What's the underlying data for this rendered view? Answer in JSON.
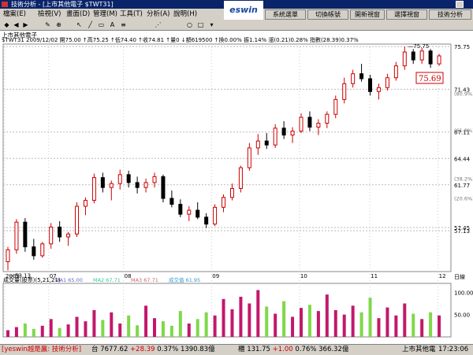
{
  "window": {
    "title": "技術分析 - [上市其他電子 $TWT31]"
  },
  "menu": {
    "items": [
      "檔案(E)",
      "檢視(V)",
      "畫面(D)",
      "管理(M)",
      "工具(T)",
      "分析(A)",
      "說明(H)"
    ]
  },
  "toolbar": {
    "brand": "eswin",
    "buttons": [
      "系統選單",
      "切換帳號",
      "開新視窗",
      "選擇視窗",
      "技術分析"
    ]
  },
  "instrument": {
    "name": "上市其他電子",
    "quote_line": "$TWT31 2009/12/02 開75.00 ↑高75.25 ↑低74.40 ↑收74.81 ↑量0 ↓額619500 ↑換0.00% 振1.14% 漲(0.21)0.28% 指數(28.39)0.37%",
    "last_price_label": "75.69"
  },
  "volume_panel": {
    "label": "成交量(股票)(5,21,21)",
    "ma_labels": [
      "MA1 65.00",
      "MA2 67.71",
      "MA3 67.71",
      "成交值 61.95"
    ]
  },
  "chart_data": {
    "type": "candlestick",
    "x_month_labels": [
      "2009",
      "07",
      "08",
      "09",
      "10",
      "11",
      "12"
    ],
    "y_ticks": [
      57.13,
      57.45,
      61.77,
      64.44,
      67.11,
      71.43,
      75.75
    ],
    "y_pct_labels": [
      "(20.6%)",
      "(38.2%)",
      "(61.8%)",
      "(80.9%)"
    ],
    "annotations": {
      "high": 75.75,
      "low": 53.13,
      "last": 75.69
    },
    "volume_ticks": [
      50.0,
      100.0
    ],
    "axis_label_right": "日線",
    "candles": [
      [
        54.0,
        55.5,
        53.13,
        55.2
      ],
      [
        55.2,
        58.3,
        54.8,
        58.0
      ],
      [
        58.0,
        58.4,
        55.0,
        55.5
      ],
      [
        55.5,
        56.3,
        54.2,
        54.6
      ],
      [
        54.6,
        56.0,
        54.4,
        55.8
      ],
      [
        55.8,
        57.9,
        55.3,
        57.5
      ],
      [
        57.5,
        58.1,
        56.0,
        56.5
      ],
      [
        56.5,
        57.0,
        55.6,
        56.8
      ],
      [
        56.8,
        60.0,
        56.5,
        59.6
      ],
      [
        59.6,
        60.5,
        58.7,
        60.2
      ],
      [
        60.2,
        62.9,
        59.9,
        62.5
      ],
      [
        62.5,
        63.0,
        61.0,
        61.5
      ],
      [
        61.5,
        62.2,
        60.2,
        61.9
      ],
      [
        61.9,
        63.3,
        61.3,
        62.8
      ],
      [
        62.8,
        63.2,
        61.5,
        62.0
      ],
      [
        62.0,
        62.6,
        60.9,
        61.5
      ],
      [
        61.5,
        62.4,
        61.0,
        62.0
      ],
      [
        62.0,
        63.0,
        61.5,
        62.6
      ],
      [
        62.6,
        62.8,
        60.0,
        60.4
      ],
      [
        60.4,
        61.2,
        59.5,
        59.8
      ],
      [
        59.8,
        60.3,
        58.5,
        58.8
      ],
      [
        58.8,
        59.6,
        58.1,
        59.2
      ],
      [
        59.2,
        60.0,
        58.3,
        58.5
      ],
      [
        58.5,
        58.9,
        57.4,
        57.8
      ],
      [
        57.8,
        59.8,
        57.6,
        59.5
      ],
      [
        59.5,
        60.8,
        59.0,
        60.5
      ],
      [
        60.5,
        61.9,
        60.2,
        61.4
      ],
      [
        61.4,
        63.7,
        61.0,
        63.5
      ],
      [
        63.5,
        66.0,
        63.2,
        65.5
      ],
      [
        65.5,
        66.9,
        64.8,
        66.2
      ],
      [
        66.2,
        67.0,
        65.4,
        65.8
      ],
      [
        65.8,
        67.9,
        65.5,
        67.5
      ],
      [
        67.5,
        68.2,
        66.4,
        66.8
      ],
      [
        66.8,
        67.6,
        66.0,
        67.2
      ],
      [
        67.2,
        69.0,
        67.0,
        68.6
      ],
      [
        68.6,
        69.2,
        67.2,
        67.6
      ],
      [
        67.6,
        68.4,
        66.8,
        68.0
      ],
      [
        68.0,
        69.2,
        67.5,
        68.9
      ],
      [
        68.9,
        70.8,
        68.5,
        70.4
      ],
      [
        70.4,
        72.6,
        70.0,
        72.0
      ],
      [
        72.0,
        73.4,
        71.6,
        73.0
      ],
      [
        73.0,
        74.0,
        72.2,
        72.5
      ],
      [
        72.5,
        72.9,
        70.8,
        71.2
      ],
      [
        71.2,
        72.0,
        70.4,
        71.6
      ],
      [
        71.6,
        73.0,
        71.3,
        72.6
      ],
      [
        72.6,
        74.2,
        72.3,
        73.8
      ],
      [
        73.8,
        75.75,
        73.4,
        75.2
      ],
      [
        75.2,
        75.5,
        74.0,
        74.4
      ],
      [
        74.4,
        75.6,
        74.0,
        75.3
      ],
      [
        75.3,
        75.5,
        73.6,
        74.0
      ],
      [
        74.0,
        75.0,
        73.8,
        74.81
      ]
    ],
    "volumes": [
      15,
      22,
      30,
      18,
      25,
      40,
      20,
      28,
      45,
      35,
      60,
      38,
      55,
      30,
      48,
      26,
      70,
      42,
      35,
      25,
      58,
      30,
      40,
      55,
      48,
      85,
      62,
      90,
      75,
      105,
      68,
      52,
      80,
      45,
      65,
      72,
      58,
      95,
      60,
      50,
      70,
      55,
      88,
      42,
      66,
      48,
      75,
      52,
      40,
      55,
      48
    ]
  }
}
